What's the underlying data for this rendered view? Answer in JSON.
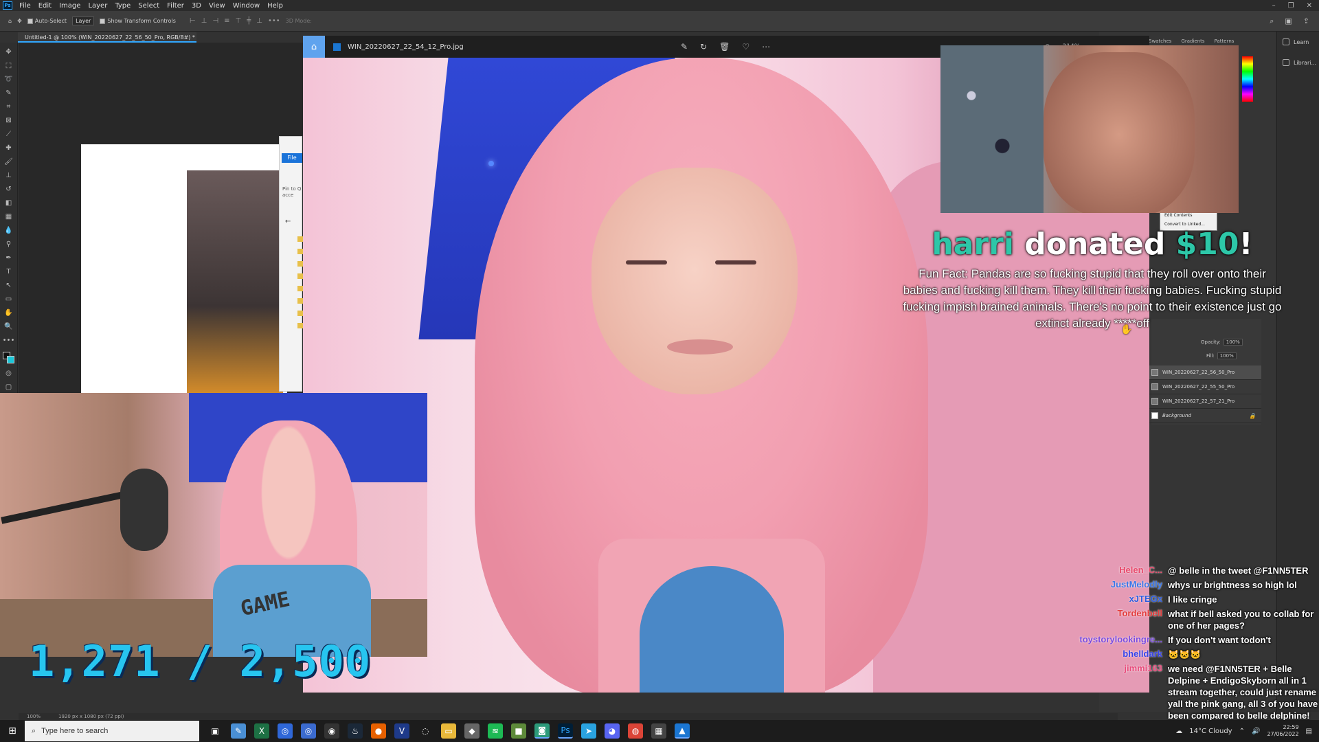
{
  "photoshop": {
    "menu": [
      "File",
      "Edit",
      "Image",
      "Layer",
      "Type",
      "Select",
      "Filter",
      "3D",
      "View",
      "Window",
      "Help"
    ],
    "options_bar": {
      "auto_select_label": "Auto-Select",
      "auto_select_value": "Layer",
      "transform_label": "Show Transform Controls",
      "mode_label": "3D Mode:"
    },
    "doc_tab": "Untitled-1 @ 100% (WIN_20220627_22_56_50_Pro, RGB/8#) *",
    "status_zoom": "100%",
    "status_info": "1920 px x 1080 px (72 ppi)",
    "right_panel": {
      "tabs": [
        "Swatches",
        "Gradients",
        "Patterns"
      ],
      "side_items": [
        "Learn",
        "Librari..."
      ],
      "context_menu": [
        "Edit Contents",
        "Convert to Linked..."
      ],
      "opacity_label": "Opacity:",
      "opacity_value": "100%",
      "fill_label": "Fill:",
      "fill_value": "100%",
      "layers": [
        {
          "name": "WIN_20220627_22_56_50_Pro",
          "selected": true
        },
        {
          "name": "WIN_20220627_22_55_50_Pro",
          "selected": false
        },
        {
          "name": "WIN_20220627_22_57_21_Pro",
          "selected": false
        },
        {
          "name": "Background",
          "selected": false
        }
      ]
    },
    "explorer": {
      "file_tab": "File",
      "pin_text": "Pin to Q acce"
    }
  },
  "photos": {
    "filename": "WIN_20220627_22_54_12_Pro.jpg",
    "zoom": "314%"
  },
  "donation": {
    "name": "harri",
    "verb": " donated ",
    "amount": "$10",
    "bang": "!",
    "message": "Fun Fact: Pandas are so fucking stupid that they roll over onto their babies and fucking kill them. They kill their fucking babies. Fucking stupid fucking impish brained animals. There's no point to their existence just go extinct already *****off"
  },
  "goal": "1,271 / 2,500",
  "chat": [
    {
      "user": "Helen_C...",
      "color": "#e8496b",
      "message": "@ belle in the tweet @F1NN5TER"
    },
    {
      "user": "JustMelodly",
      "color": "#3a76e8",
      "message": "whys ur brightness so high lol"
    },
    {
      "user": "xJTEGx",
      "color": "#2b5ce0",
      "message": "I like cringe"
    },
    {
      "user": "Tordenbell",
      "color": "#e33c3c",
      "message": "what if bell asked you to collab for one of her pages?"
    },
    {
      "user": "toystorylookingre...",
      "color": "#7b4be0",
      "message": "If you don't want todon't"
    },
    {
      "user": "bhelldark",
      "color": "#3742e8",
      "message": "🐱🐱🐱"
    },
    {
      "user": "jimmi163",
      "color": "#e84b7b",
      "message": "we need @F1NN5TER + Belle Delpine + EndigoSkyborn all in 1 stream together, could just rename yall the pink gang, all 3 of you have been compared to belle delphine!"
    }
  ],
  "taskbar": {
    "search_placeholder": "Type here to search",
    "weather": "14°C  Cloudy",
    "time": "22:59",
    "date": "27/06/2022"
  }
}
